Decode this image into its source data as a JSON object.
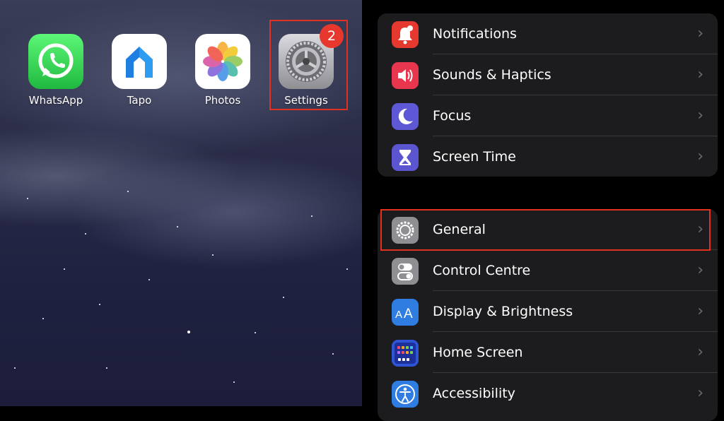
{
  "home_screen": {
    "apps": [
      {
        "label": "WhatsApp",
        "icon": "whatsapp-icon"
      },
      {
        "label": "Tapo",
        "icon": "tapo-icon"
      },
      {
        "label": "Photos",
        "icon": "photos-icon"
      },
      {
        "label": "Settings",
        "icon": "settings-gear-icon"
      }
    ],
    "settings_badge": "2",
    "highlight_color": "#e0321f"
  },
  "settings": {
    "group1": [
      {
        "label": "Notifications",
        "icon": "bell-icon",
        "color": "#e5382f"
      },
      {
        "label": "Sounds & Haptics",
        "icon": "speaker-icon",
        "color": "#e8364f"
      },
      {
        "label": "Focus",
        "icon": "moon-icon",
        "color": "#5e58d6"
      },
      {
        "label": "Screen Time",
        "icon": "hourglass-icon",
        "color": "#5b55d0"
      }
    ],
    "group2": [
      {
        "label": "General",
        "icon": "gear-icon",
        "color": "#8e8e93"
      },
      {
        "label": "Control Centre",
        "icon": "toggles-icon",
        "color": "#8e8e93"
      },
      {
        "label": "Display & Brightness",
        "icon": "text-size-icon",
        "color": "#2f7de1"
      },
      {
        "label": "Home Screen",
        "icon": "app-grid-icon",
        "color": "#2f55d6"
      },
      {
        "label": "Accessibility",
        "icon": "accessibility-icon",
        "color": "#2f7de1"
      }
    ],
    "chevron": "›"
  }
}
